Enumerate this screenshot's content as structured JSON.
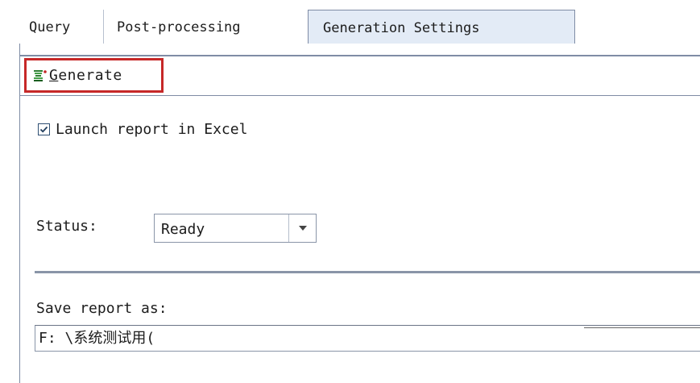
{
  "tabs": [
    {
      "label": "Query"
    },
    {
      "label": "Post-processing"
    },
    {
      "label": "Generation Settings",
      "active": true
    }
  ],
  "toolbar": {
    "generate_label_mnemonic": "G",
    "generate_label_rest": "enerate",
    "icon": "generate-icon"
  },
  "options": {
    "launch_excel_label": "Launch report in Excel",
    "launch_excel_checked": true
  },
  "status": {
    "label": "Status:",
    "value": "Ready"
  },
  "save": {
    "label": "Save report as:",
    "path": "F: \\系统测试用("
  },
  "colors": {
    "highlight_box": "#c62828",
    "active_tab_bg": "#e3ebf6",
    "border": "#7f8ca5"
  }
}
